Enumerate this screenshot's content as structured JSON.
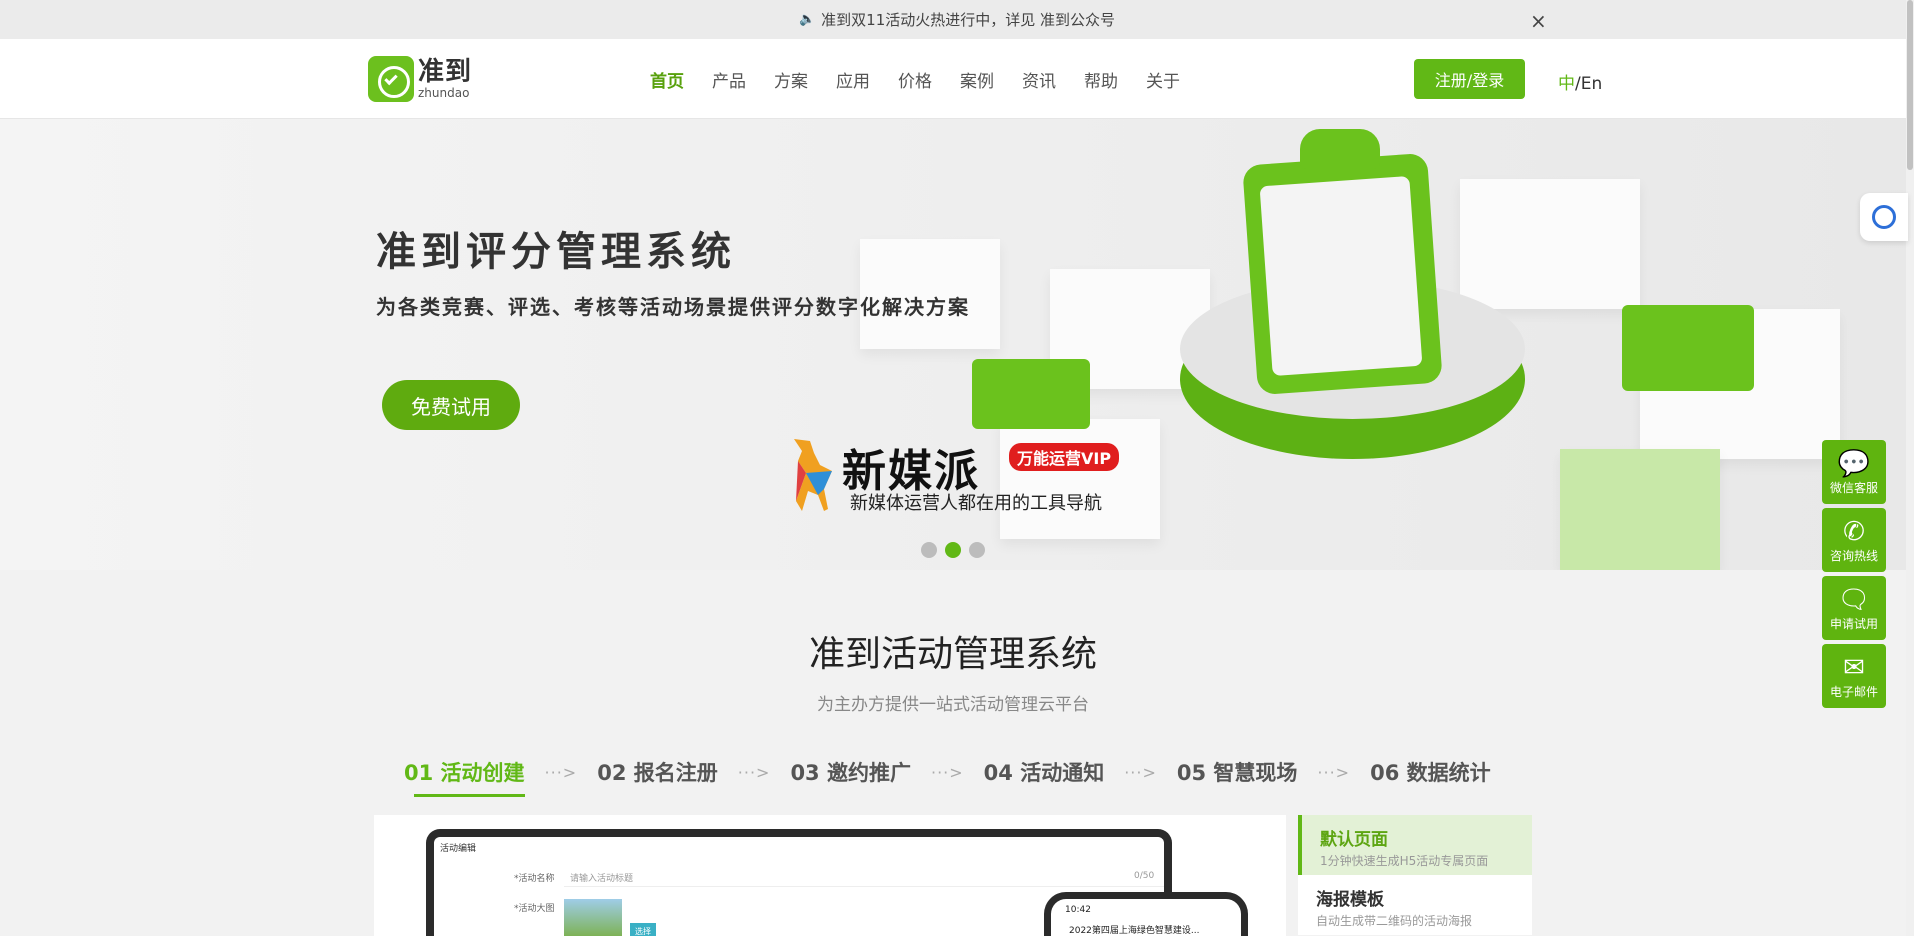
{
  "notice": {
    "text": "准到双11活动火热进行中，详见 准到公众号",
    "close": "×"
  },
  "header": {
    "logo_cn": "准到",
    "logo_en": "zhundao",
    "nav": [
      "首页",
      "产品",
      "方案",
      "应用",
      "价格",
      "案例",
      "资讯",
      "帮助",
      "关于"
    ],
    "login": "注册/登录",
    "lang_cn": "中",
    "lang_sep_en": "/En"
  },
  "hero": {
    "title": "准到评分管理系统",
    "subtitle": "为各类竞赛、评选、考核等活动场景提供评分数字化解决方案",
    "cta": "免费试用",
    "promo_title": "新媒派",
    "promo_badge": "万能运营VIP",
    "promo_sub": "新媒体运营人都在用的工具导航"
  },
  "side_tools": [
    {
      "label": "微信客服",
      "icon": "wechat-icon"
    },
    {
      "label": "咨询热线",
      "icon": "phone-icon"
    },
    {
      "label": "申请试用",
      "icon": "chat-icon"
    },
    {
      "label": "电子邮件",
      "icon": "mail-icon"
    }
  ],
  "section": {
    "title": "准到活动管理系统",
    "subtitle": "为主办方提供一站式活动管理云平台",
    "steps": [
      "01 活动创建",
      "02 报名注册",
      "03 邀约推广",
      "04 活动通知",
      "05 智慧现场",
      "06 数据统计"
    ],
    "arrow": "···>",
    "preview": {
      "window_title": "活动编辑",
      "name_label": "*活动名称",
      "name_placeholder": "请输入活动标题",
      "counter": "0/50",
      "banner_label": "*活动大图",
      "pick_btn": "选择",
      "phone_time": "10:42",
      "phone_title": "2022第四届上海绿色智慧建设..."
    },
    "features": [
      {
        "title": "默认页面",
        "desc": "1分钟快速生成H5活动专属页面"
      },
      {
        "title": "海报模板",
        "desc": "自动生成带二维码的活动海报"
      }
    ]
  },
  "colors": {
    "brand": "#61b816",
    "promo_badge": "#e01e1e"
  }
}
